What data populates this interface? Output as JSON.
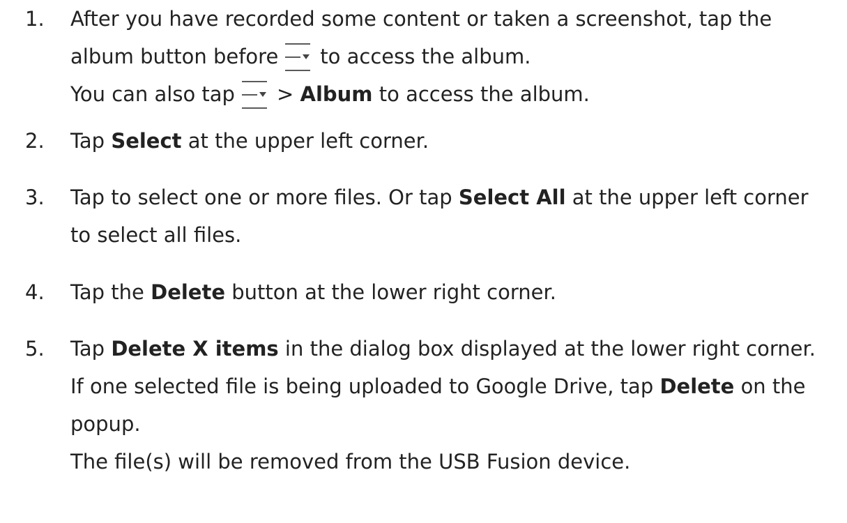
{
  "steps": [
    {
      "number": "1.",
      "line1_before": "After you have recorded some content or taken a screenshot, tap the",
      "line2_before": "album button before",
      "line2_after": "to access the album.",
      "line3_before": "You can also tap",
      "line3_sep": ">",
      "line3_bold": "Album",
      "line3_after": "to access the album.",
      "icon": "menu-dropdown-icon"
    },
    {
      "number": "2.",
      "before": "Tap",
      "bold": "Select",
      "after": "at the upper left corner."
    },
    {
      "number": "3.",
      "line1_before": "Tap to select one or more files. Or tap",
      "line1_bold": "Select All",
      "line1_after": "at the upper left corner",
      "line2": "to select all files."
    },
    {
      "number": "4.",
      "before": "Tap the",
      "bold": "Delete",
      "after": "button at the lower right corner."
    },
    {
      "number": "5.",
      "line1_before": "Tap",
      "line1_bold": "Delete X items",
      "line1_after": "in the dialog box displayed at the lower right corner.",
      "line2_before": "If one selected file is being uploaded to Google Drive, tap",
      "line2_bold": "Delete",
      "line2_after": "on the",
      "line3": "popup.",
      "line4": "The file(s) will be removed from the USB Fusion device."
    }
  ]
}
